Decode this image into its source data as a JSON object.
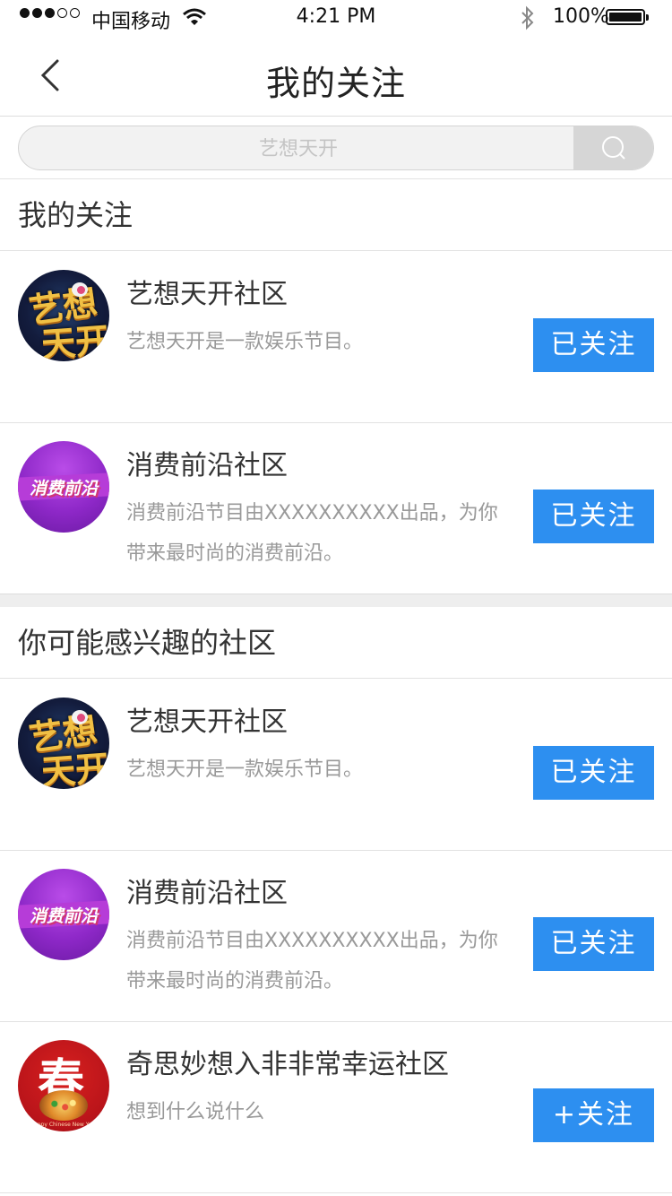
{
  "status_bar": {
    "carrier": "中国移动",
    "time": "4:21 PM",
    "battery": "100%",
    "icons": [
      "signal-icon",
      "wifi-icon",
      "bluetooth-icon",
      "battery-icon"
    ]
  },
  "nav": {
    "title": "我的关注",
    "back_icon": "chevron-left-icon"
  },
  "search": {
    "placeholder": "艺想天开",
    "icon": "search-icon"
  },
  "my_follow": {
    "header": "我的关注",
    "items": [
      {
        "name": "艺想天开社区",
        "desc": "艺想天开是一款娱乐节目。",
        "button": "已关注",
        "avatar_text": [
          "艺想",
          "天开"
        ]
      },
      {
        "name": "消费前沿社区",
        "desc": "消费前沿节目由XXXXXXXXXX出品，为你带来最时尚的消费前沿。",
        "button": "已关注",
        "avatar_text": "消费前沿"
      }
    ]
  },
  "suggested": {
    "header": "你可能感兴趣的社区",
    "items": [
      {
        "name": "艺想天开社区",
        "desc": "艺想天开是一款娱乐节目。",
        "button": "已关注",
        "avatar_text": [
          "艺想",
          "天开"
        ]
      },
      {
        "name": "消费前沿社区",
        "desc": "消费前沿节目由XXXXXXXXXX出品，为你带来最时尚的消费前沿。",
        "button": "已关注",
        "avatar_text": "消费前沿"
      },
      {
        "name": "奇思妙想入非非常幸运社区",
        "desc": "想到什么说什么",
        "button": "+关注",
        "avatar_text": "春",
        "avatar_caption": "Happy Chinese New Year"
      }
    ]
  },
  "colors": {
    "accent": "#2d8ff0",
    "divider": "#e2e2e2",
    "muted_text": "#999999",
    "section_gap": "#eeeeee"
  }
}
